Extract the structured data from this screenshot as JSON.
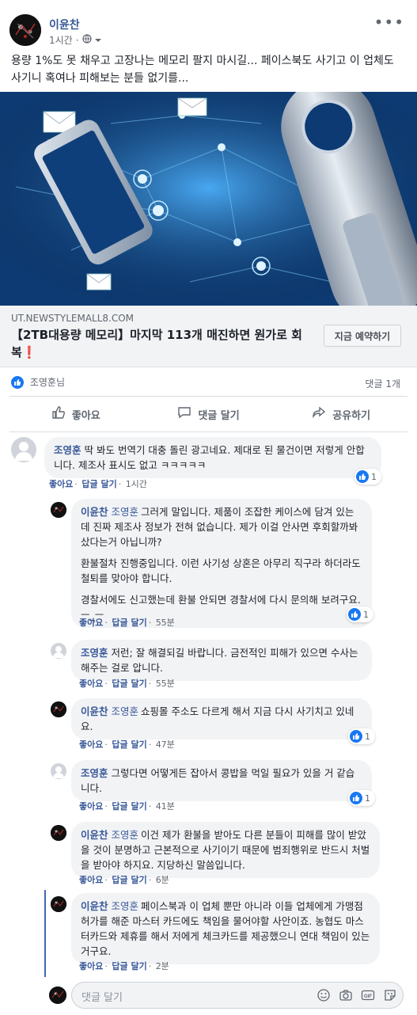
{
  "post": {
    "author": "이윤찬",
    "time": "1시간",
    "body": "용량 1%도 못 채우고 고장나는 메모리 팔지 마시길... 페이스북도 사기고 이 업체도 사기니 혹여나 피해보는 분들 없기를...",
    "link": {
      "domain": "UT.NEWSTYLEMALL8.COM",
      "title": "【2TB대용량 메모리】마지막 113개 매진하면 원가로 회복❗",
      "cta": "지금 예약하기"
    },
    "reactions": {
      "who": "조영훈님",
      "comment_count": "댓글 1개"
    },
    "actions": {
      "like": "좋아요",
      "comment": "댓글 달기",
      "share": "공유하기"
    }
  },
  "comments": [
    {
      "name": "조영훈",
      "tag": "",
      "paragraphs": [
        "딱 봐도 번역기 대충 돌린 광고네요. 제대로 된 물건이면 저렇게 안합니다. 제조사 표시도 없고 ㅋㅋㅋㅋㅋ"
      ],
      "like_label": "좋아요",
      "reply_label": "답글 달기",
      "time": "1시간",
      "reaction_count": "1"
    },
    {
      "name": "이윤찬",
      "tag": "조영훈",
      "paragraphs": [
        "그러게 말입니다. 제품이 조잡한 케이스에 담겨 있는데 진짜 제조사 정보가 전혀 없습니다. 제가 이걸 안사면 후회할까봐 샀다는거 아닙니까?",
        "환불절차 진행중입니다. 이런 사기성 상혼은 아무리 직구라 하더라도 철퇴를 맞아야 합니다.",
        "경찰서에도 신고했는데 환불 안되면 경찰서에 다시 문의해 보려구요. ㅡ_ㅡ"
      ],
      "like_label": "좋아요",
      "reply_label": "답글 달기",
      "time": "55분",
      "reaction_count": "1"
    },
    {
      "name": "조영훈",
      "tag": "",
      "paragraphs": [
        "저런; 잘 해결되길 바랍니다. 금전적인 피해가 있으면 수사는 해주는 걸로 압니다."
      ],
      "like_label": "좋아요",
      "reply_label": "답글 달기",
      "time": "55분",
      "reaction_count": ""
    },
    {
      "name": "이윤찬",
      "tag": "조영훈",
      "paragraphs": [
        "쇼핑몰 주소도 다르게 해서 지금 다시 사기치고 있네요."
      ],
      "like_label": "좋아요",
      "reply_label": "답글 달기",
      "time": "47분",
      "reaction_count": "1"
    },
    {
      "name": "조영훈",
      "tag": "",
      "paragraphs": [
        "그렇다면 어떻게든 잡아서 콩밥을 먹일 필요가 있을 거 같습니다."
      ],
      "like_label": "좋아요",
      "reply_label": "답글 달기",
      "time": "41분",
      "reaction_count": "1"
    },
    {
      "name": "이윤찬",
      "tag": "조영훈",
      "paragraphs": [
        "이건 제가 환불을 받아도 다른 분들이 피해를 많이 받았을 것이 분명하고 근본적으로 사기이기 때문에 범죄행위로 반드시 처벌을 받아야 하지요. 지당하신 말씀입니다."
      ],
      "like_label": "좋아요",
      "reply_label": "답글 달기",
      "time": "6분",
      "reaction_count": ""
    },
    {
      "name": "이윤찬",
      "tag": "조영훈",
      "paragraphs": [
        "페이스북과 이 업체 뿐만 아니라 이들 업체에게 가맹점 허가를 해준 마스터 카드에도 책임을 물어야할 사안이죠. 농협도 마스터카드와 제휴를 해서 저에게 체크카드를 제공했으니 연대 책임이 있는 거구요."
      ],
      "like_label": "좋아요",
      "reply_label": "답글 달기",
      "time": "2분",
      "reaction_count": ""
    }
  ],
  "compose": {
    "placeholder": "댓글 달기"
  },
  "colors": {
    "brand": "#4267b2",
    "link": "#385898",
    "like": "#1877f2"
  }
}
